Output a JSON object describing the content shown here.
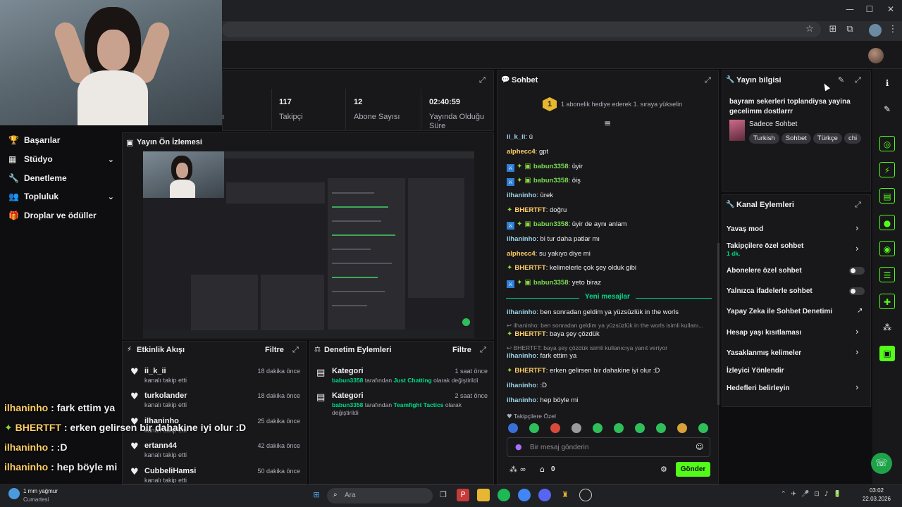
{
  "browser": {
    "controls": [
      "—",
      "☐",
      "✕"
    ]
  },
  "nav": {
    "items": [
      {
        "label": "Başarılar"
      },
      {
        "label": "Stüdyo"
      },
      {
        "label": "Denetleme"
      },
      {
        "label": "Topluluk"
      },
      {
        "label": "Droplar ve ödüller"
      }
    ]
  },
  "stats": {
    "cells": [
      {
        "value": "117",
        "label": "Takipçi"
      },
      {
        "value": "12",
        "label": "Abone Sayısı"
      },
      {
        "value": "02:40:59",
        "label": "Yayında Olduğu Süre"
      }
    ],
    "partial_label": "ı"
  },
  "preview": {
    "title": "Yayın Ön İzlemesi"
  },
  "activity": {
    "title": "Etkinlik Akışı",
    "filter": "Filtre",
    "items": [
      {
        "name": "ii_k_ii",
        "action": "kanalı takip etti",
        "time": "18 dakika önce"
      },
      {
        "name": "turkolander",
        "action": "kanalı takip etti",
        "time": "18 dakika önce"
      },
      {
        "name": "ilhaninho",
        "action": "kanalı takip etti",
        "time": "25 dakika önce"
      },
      {
        "name": "ertann44",
        "action": "kanalı takip etti",
        "time": "42 dakika önce"
      },
      {
        "name": "CubbeliHamsi",
        "action": "kanalı takip etti",
        "time": "50 dakika önce"
      }
    ]
  },
  "moderation": {
    "title": "Denetim Eylemleri",
    "filter": "Filtre",
    "items": [
      {
        "title": "Kategori",
        "user": "babun3358",
        "mid": "tarafından",
        "category": "Just Chatting",
        "tail": "olarak değiştirildi",
        "time": "1 saat önce"
      },
      {
        "title": "Kategori",
        "user": "babun3358",
        "mid": "tarafından",
        "category": "Teamfight Tactics",
        "tail": "olarak değiştirildi",
        "time": "2 saat önce"
      }
    ]
  },
  "chat": {
    "title": "Sohbet",
    "gift_badge": "1",
    "gift_text": "1 abonelik hediye ederek 1. sıraya yükselin",
    "messages": [
      {
        "user": "ii_k_ii",
        "text": "ü",
        "style": "ilh"
      },
      {
        "user": "alphecc4",
        "text": "gpt",
        "style": "alp"
      },
      {
        "user": "babun3358",
        "text": "üyir",
        "style": "bab"
      },
      {
        "user": "babun3358",
        "text": "öiş",
        "style": "bab"
      },
      {
        "user": "ilhaninho",
        "text": "ürek",
        "style": "ilh"
      },
      {
        "user": "BHERTFT",
        "text": "doğru",
        "style": "bh"
      },
      {
        "user": "babun3358",
        "text": "üyir de aynı anlam",
        "style": "bab"
      },
      {
        "user": "ilhaninho",
        "text": "bi tur daha patlar mı",
        "style": "ilh"
      },
      {
        "user": "alphecc4",
        "text": "su yakıyo diye mi",
        "style": "alp"
      },
      {
        "user": "BHERTFT",
        "text": "kelimelerle çok şey olduk gibi",
        "style": "bh"
      },
      {
        "user": "babun3358",
        "text": "yeto biraz",
        "style": "bab"
      }
    ],
    "new_divider": "Yeni mesajlar",
    "new_messages": [
      {
        "reply": "",
        "user": "ilhaninho",
        "text": "ben sonradan geldim ya yüzsüzlük in the worls",
        "style": "ilh"
      },
      {
        "reply": "ilhaninho: ben sonradan geldim ya yüzsüzlük in the worls isimli kullanı...",
        "user": "BHERTFT",
        "text": "baya şey çözdük",
        "style": "bh"
      },
      {
        "reply": "BHERTFT: baya şey çözdük isimli kullanıcıya yanıt veriyor",
        "user": "ilhaninho",
        "text": "fark ettim ya",
        "style": "ilh"
      },
      {
        "reply": "",
        "user": "BHERTFT",
        "text": "erken gelirsen bir dahakine iyi olur :D",
        "style": "bh"
      },
      {
        "reply": "",
        "user": "ilhaninho",
        "text": ":D",
        "style": "ilh"
      },
      {
        "reply": "",
        "user": "ilhaninho",
        "text": "hep böyle mi",
        "style": "ilh"
      }
    ],
    "followers_only": "Takipçilere Özel",
    "input_placeholder": "Bir mesaj gönderin",
    "points": "0",
    "send": "Gönder"
  },
  "stream_info": {
    "title": "Yayın bilgisi",
    "stream_title": "bayram sekerleri toplandiysa yayina gecelimm dostlarrr",
    "category": "Sadece Sohbet",
    "tags": [
      "Turkish",
      "Sohbet",
      "Türkçe",
      "chi"
    ]
  },
  "channel_actions": {
    "title": "Kanal Eylemleri",
    "items": [
      {
        "label": "Yavaş mod",
        "sub": "",
        "control": "chevron"
      },
      {
        "label": "Takipçilere özel sohbet",
        "sub": "1 dk.",
        "control": "chevron"
      },
      {
        "label": "Abonelere özel sohbet",
        "sub": "",
        "control": "toggle"
      },
      {
        "label": "Yalnızca ifadelerle sohbet",
        "sub": "",
        "control": "toggle"
      },
      {
        "label": "Yapay Zeka ile Sohbet Denetimi",
        "sub": "",
        "control": "external"
      },
      {
        "label": "Hesap yaşı kısıtlaması",
        "sub": "",
        "control": "chevron"
      },
      {
        "label": "Yasaklanmış kelimeler",
        "sub": "",
        "control": "chevron"
      },
      {
        "label": "İzleyici Yönlendir",
        "sub": "",
        "control": "none"
      },
      {
        "label": "Hedefleri belirleyin",
        "sub": "",
        "control": "chevron"
      }
    ]
  },
  "overlay": {
    "lines": [
      {
        "user": "ilhaninho",
        "text": ": fark ettim ya"
      },
      {
        "user": "BHERTFT",
        "text": ": erken gelirsen bir dahakine iyi olur :D"
      },
      {
        "user": "ilhaninho",
        "text": ": :D"
      },
      {
        "user": "ilhaninho",
        "text": ": hep böyle mi"
      }
    ]
  },
  "taskbar": {
    "weather_temp": "1 mm yağmur",
    "weather_day": "Cumartesi",
    "search": "Ara",
    "time": "03:02",
    "date": "22.03.2026"
  },
  "colors": {
    "accent": "#00db84",
    "send_button": "#53fc18",
    "background": "#0e0e10",
    "panel": "#18181b"
  }
}
